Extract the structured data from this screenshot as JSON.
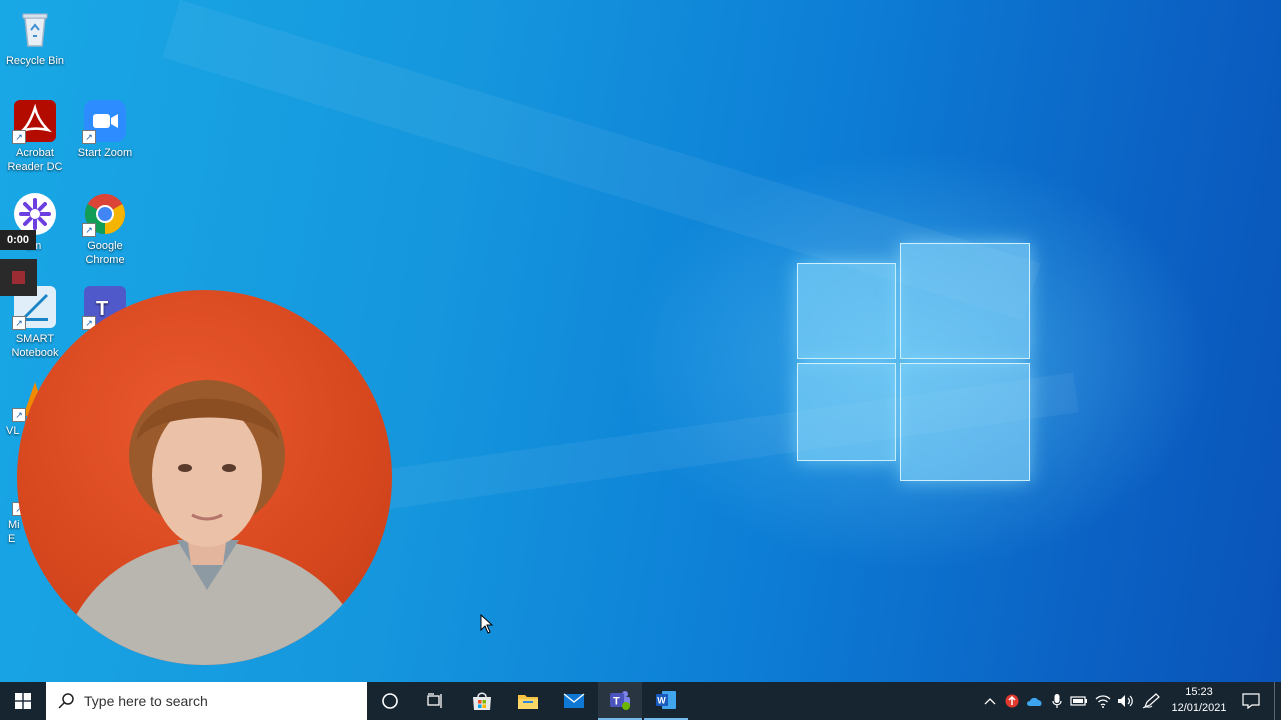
{
  "desktop": {
    "icons": [
      {
        "label": "Recycle Bin"
      },
      {
        "label": "Acrobat Reader DC"
      },
      {
        "label": "Start Zoom"
      },
      {
        "label": "om"
      },
      {
        "label": "Google Chrome"
      },
      {
        "label": "SMART Notebook"
      },
      {
        "label": "VL"
      },
      {
        "label": "Mi E"
      }
    ]
  },
  "recorder": {
    "time": "0:00"
  },
  "taskbar": {
    "search_placeholder": "Type here to search",
    "pinned_apps": [
      "cortana-icon",
      "task-view-icon",
      "store-icon",
      "file-explorer-icon",
      "mail-icon",
      "teams-icon",
      "word-icon"
    ],
    "tray_icons": [
      "chevron-up-icon",
      "upload-icon",
      "onedrive-icon",
      "microphone-icon",
      "battery-icon",
      "wifi-icon",
      "volume-icon",
      "pen-icon"
    ],
    "clock_time": "15:23",
    "clock_date": "12/01/2021"
  },
  "colors": {
    "taskbar": "#172531",
    "desktop_accent": "#0d7fd6",
    "teams": "#5059c9",
    "word": "#2b579a"
  }
}
